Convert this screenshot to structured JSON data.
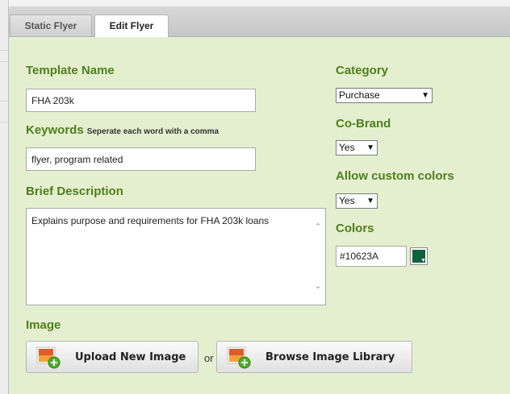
{
  "tabs": [
    {
      "label": "Static Flyer"
    },
    {
      "label": "Edit Flyer"
    }
  ],
  "form": {
    "template_name": {
      "label": "Template Name",
      "value": "FHA 203k"
    },
    "keywords": {
      "label": "Keywords",
      "hint": "Seperate each word with a comma",
      "value": "flyer, program related"
    },
    "description": {
      "label": "Brief Description",
      "value": "Explains purpose and requirements for FHA 203k loans"
    },
    "category": {
      "label": "Category",
      "value": "Purchase"
    },
    "cobrand": {
      "label": "Co-Brand",
      "value": "Yes"
    },
    "custom_colors": {
      "label": "Allow custom colors",
      "value": "Yes"
    },
    "colors": {
      "label": "Colors",
      "value": "#10623A"
    },
    "image": {
      "label": "Image"
    }
  },
  "buttons": {
    "upload": "Upload New Image",
    "or": "or",
    "browse": "Browse Image Library"
  },
  "theme": {
    "label_green": "#4e7f1c",
    "panel_bg": "#e4efcf",
    "swatch_color": "#10623A"
  },
  "icons": {
    "caret": "chevron-down-icon",
    "scroll_up": "scroll-up-arrow-icon",
    "scroll_down": "scroll-down-arrow-icon",
    "image_add": "image-add-icon"
  }
}
